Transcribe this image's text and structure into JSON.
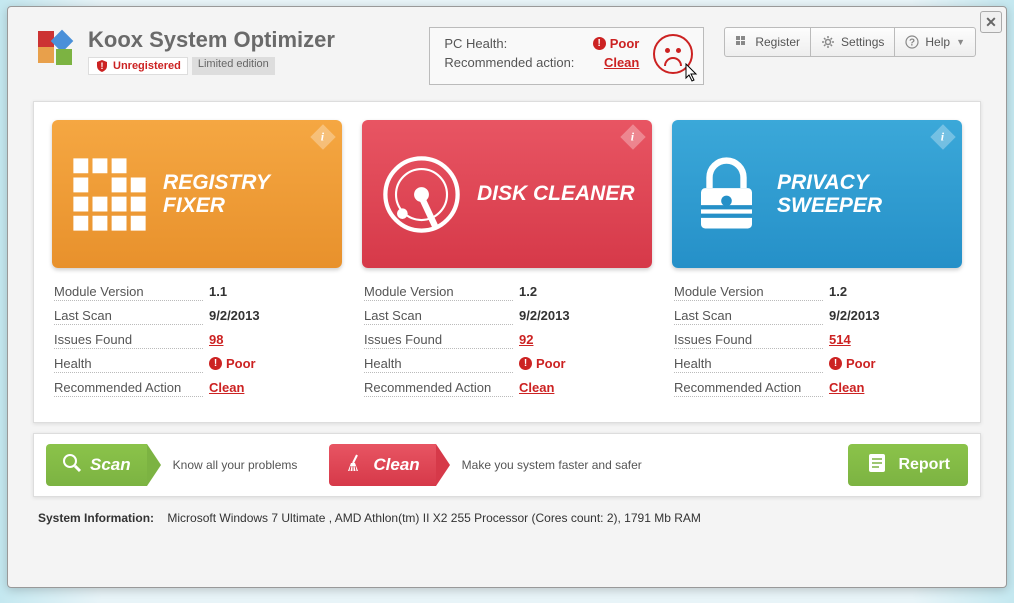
{
  "app": {
    "title": "Koox System Optimizer",
    "unregistered": "Unregistered",
    "limited": "Limited edition"
  },
  "health": {
    "pc_health_label": "PC Health:",
    "pc_health_value": "Poor",
    "rec_label": "Recommended action:",
    "rec_value": "Clean"
  },
  "toolbar": {
    "register": "Register",
    "settings": "Settings",
    "help": "Help"
  },
  "cards": [
    {
      "title": "REGISTRY FIXER",
      "details": {
        "version_label": "Module Version",
        "version": "1.1",
        "last_scan_label": "Last Scan",
        "last_scan": "9/2/2013",
        "issues_label": "Issues Found",
        "issues": "98",
        "health_label": "Health",
        "health": "Poor",
        "rec_label": "Recommended Action",
        "rec": "Clean"
      }
    },
    {
      "title": "DISK CLEANER",
      "details": {
        "version_label": "Module Version",
        "version": "1.2",
        "last_scan_label": "Last Scan",
        "last_scan": "9/2/2013",
        "issues_label": "Issues Found",
        "issues": "92",
        "health_label": "Health",
        "health": "Poor",
        "rec_label": "Recommended Action",
        "rec": "Clean"
      }
    },
    {
      "title": "PRIVACY SWEEPER",
      "details": {
        "version_label": "Module Version",
        "version": "1.2",
        "last_scan_label": "Last Scan",
        "last_scan": "9/2/2013",
        "issues_label": "Issues Found",
        "issues": "514",
        "health_label": "Health",
        "health": "Poor",
        "rec_label": "Recommended Action",
        "rec": "Clean"
      }
    }
  ],
  "actions": {
    "scan": "Scan",
    "scan_desc": "Know all your problems",
    "clean": "Clean",
    "clean_desc": "Make you system faster and safer",
    "report": "Report"
  },
  "footer": {
    "label": "System Information:",
    "text": "Microsoft Windows 7 Ultimate , AMD Athlon(tm) II X2 255 Processor (Cores count: 2), 1791 Mb RAM"
  }
}
